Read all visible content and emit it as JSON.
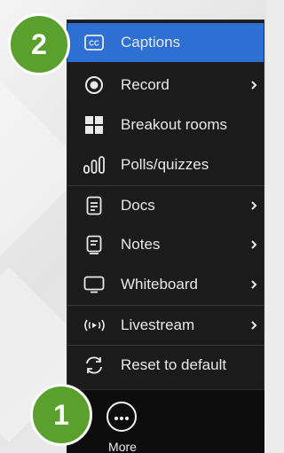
{
  "menu": {
    "items": [
      {
        "label": "Captions",
        "icon": "cc-icon",
        "active": true,
        "has_submenu": false
      },
      {
        "label": "Record",
        "icon": "record-icon",
        "active": false,
        "has_submenu": true
      },
      {
        "label": "Breakout rooms",
        "icon": "grid-icon",
        "active": false,
        "has_submenu": false
      },
      {
        "label": "Polls/quizzes",
        "icon": "bar-chart-icon",
        "active": false,
        "has_submenu": false
      },
      {
        "label": "Docs",
        "icon": "document-icon",
        "active": false,
        "has_submenu": true
      },
      {
        "label": "Notes",
        "icon": "notes-icon",
        "active": false,
        "has_submenu": true
      },
      {
        "label": "Whiteboard",
        "icon": "whiteboard-icon",
        "active": false,
        "has_submenu": true
      },
      {
        "label": "Livestream",
        "icon": "livestream-icon",
        "active": false,
        "has_submenu": true
      },
      {
        "label": "Reset to default",
        "icon": "reset-icon",
        "active": false,
        "has_submenu": false
      }
    ]
  },
  "toolbar": {
    "more_label": "More",
    "more_icon": "more-icon"
  },
  "callouts": {
    "step_1": "1",
    "step_2": "2"
  },
  "colors": {
    "menu_background": "#1b1b1b",
    "active_item": "#2d6fd2",
    "bottom_bar": "#0d0d0d",
    "callout_badge": "#5aa02c",
    "text": "#e9e9e9"
  }
}
